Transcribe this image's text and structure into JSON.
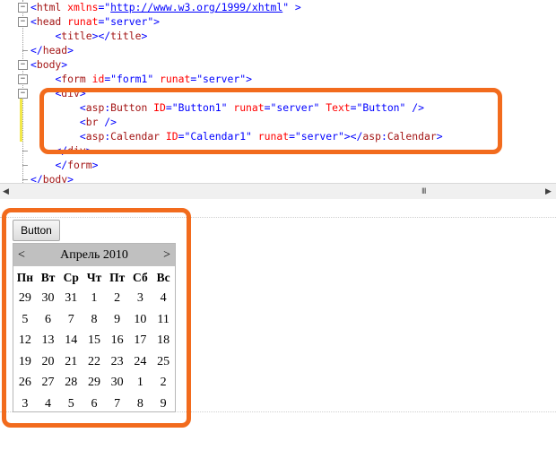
{
  "code": {
    "lines": [
      {
        "fold": "-",
        "parts": [
          {
            "c": "t",
            "s": "<"
          },
          {
            "c": "tg",
            "s": "html"
          },
          {
            "c": "at",
            "s": " xmlns"
          },
          {
            "c": "t",
            "s": "=\""
          },
          {
            "c": "lnk",
            "s": "http://www.w3.org/1999/xhtml"
          },
          {
            "c": "t",
            "s": "\""
          },
          {
            "c": "t",
            "s": " >"
          }
        ]
      },
      {
        "fold": "-",
        "parts": [
          {
            "c": "t",
            "s": "<"
          },
          {
            "c": "tg",
            "s": "head"
          },
          {
            "c": "at",
            "s": " runat"
          },
          {
            "c": "t",
            "s": "=\"server\">"
          }
        ]
      },
      {
        "fold": "",
        "parts": [
          {
            "c": "",
            "s": "    "
          },
          {
            "c": "t",
            "s": "<"
          },
          {
            "c": "tg",
            "s": "title"
          },
          {
            "c": "t",
            "s": "></"
          },
          {
            "c": "tg",
            "s": "title"
          },
          {
            "c": "t",
            "s": ">"
          }
        ]
      },
      {
        "fold": "end",
        "parts": [
          {
            "c": "t",
            "s": "</"
          },
          {
            "c": "tg",
            "s": "head"
          },
          {
            "c": "t",
            "s": ">"
          }
        ]
      },
      {
        "fold": "-",
        "parts": [
          {
            "c": "t",
            "s": "<"
          },
          {
            "c": "tg",
            "s": "body"
          },
          {
            "c": "t",
            "s": ">"
          }
        ]
      },
      {
        "fold": "-",
        "parts": [
          {
            "c": "",
            "s": "    "
          },
          {
            "c": "t",
            "s": "<"
          },
          {
            "c": "tg",
            "s": "form"
          },
          {
            "c": "at",
            "s": " id"
          },
          {
            "c": "t",
            "s": "=\"form1\""
          },
          {
            "c": "at",
            "s": " runat"
          },
          {
            "c": "t",
            "s": "=\"server\">"
          }
        ]
      },
      {
        "fold": "-",
        "parts": [
          {
            "c": "",
            "s": "    "
          },
          {
            "c": "t",
            "s": "<"
          },
          {
            "c": "tg",
            "s": "div"
          },
          {
            "c": "t",
            "s": ">"
          }
        ]
      },
      {
        "fold": "",
        "parts": [
          {
            "c": "",
            "s": "        "
          },
          {
            "c": "t",
            "s": "<"
          },
          {
            "c": "tg",
            "s": "asp"
          },
          {
            "c": "t",
            "s": ":"
          },
          {
            "c": "tg",
            "s": "Button"
          },
          {
            "c": "at",
            "s": " ID"
          },
          {
            "c": "t",
            "s": "=\"Button1\""
          },
          {
            "c": "at",
            "s": " runat"
          },
          {
            "c": "t",
            "s": "=\"server\""
          },
          {
            "c": "at",
            "s": " Text"
          },
          {
            "c": "t",
            "s": "=\"Button\" />"
          }
        ]
      },
      {
        "fold": "",
        "parts": [
          {
            "c": "",
            "s": "        "
          },
          {
            "c": "t",
            "s": "<"
          },
          {
            "c": "tg",
            "s": "br"
          },
          {
            "c": "t",
            "s": " />"
          }
        ]
      },
      {
        "fold": "",
        "parts": [
          {
            "c": "",
            "s": "        "
          },
          {
            "c": "t",
            "s": "<"
          },
          {
            "c": "tg",
            "s": "asp"
          },
          {
            "c": "t",
            "s": ":"
          },
          {
            "c": "tg",
            "s": "Calendar"
          },
          {
            "c": "at",
            "s": " ID"
          },
          {
            "c": "t",
            "s": "=\"Calendar1\""
          },
          {
            "c": "at",
            "s": " runat"
          },
          {
            "c": "t",
            "s": "=\"server\"></"
          },
          {
            "c": "tg",
            "s": "asp"
          },
          {
            "c": "t",
            "s": ":"
          },
          {
            "c": "tg",
            "s": "Calendar"
          },
          {
            "c": "t",
            "s": ">"
          }
        ]
      },
      {
        "fold": "end",
        "parts": [
          {
            "c": "",
            "s": "    "
          },
          {
            "c": "t",
            "s": "</"
          },
          {
            "c": "tg",
            "s": "div"
          },
          {
            "c": "t",
            "s": ">"
          }
        ]
      },
      {
        "fold": "end",
        "parts": [
          {
            "c": "",
            "s": "    "
          },
          {
            "c": "t",
            "s": "</"
          },
          {
            "c": "tg",
            "s": "form"
          },
          {
            "c": "t",
            "s": ">"
          }
        ]
      },
      {
        "fold": "end",
        "parts": [
          {
            "c": "t",
            "s": "</"
          },
          {
            "c": "tg",
            "s": "body"
          },
          {
            "c": "t",
            "s": ">"
          }
        ]
      }
    ]
  },
  "scrollbar": {
    "left_arrow": "◀",
    "grip": "III",
    "right_arrow": "▶"
  },
  "design": {
    "button_text": "Button",
    "calendar": {
      "prev": "<",
      "next": ">",
      "month_title": "Апрель 2010",
      "day_names": [
        "Пн",
        "Вт",
        "Ср",
        "Чт",
        "Пт",
        "Сб",
        "Вс"
      ],
      "weeks": [
        [
          "29",
          "30",
          "31",
          "1",
          "2",
          "3",
          "4"
        ],
        [
          "5",
          "6",
          "7",
          "8",
          "9",
          "10",
          "11"
        ],
        [
          "12",
          "13",
          "14",
          "15",
          "16",
          "17",
          "18"
        ],
        [
          "19",
          "20",
          "21",
          "22",
          "23",
          "24",
          "25"
        ],
        [
          "26",
          "27",
          "28",
          "29",
          "30",
          "1",
          "2"
        ],
        [
          "3",
          "4",
          "5",
          "6",
          "7",
          "8",
          "9"
        ]
      ]
    }
  },
  "colors": {
    "callout": "#f26b1d",
    "calendar_header": "#c0c0c0"
  }
}
